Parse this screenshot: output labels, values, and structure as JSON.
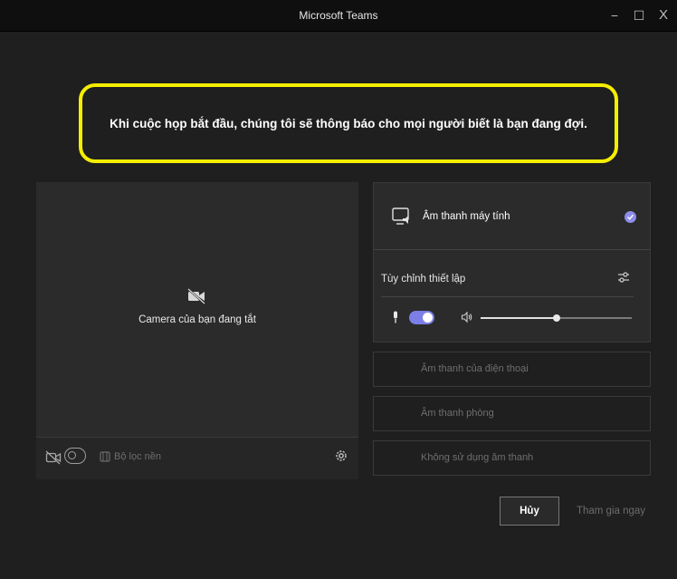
{
  "window": {
    "title": "Microsoft Teams",
    "controls": {
      "minimize": "−",
      "maximize": "☐",
      "close": "X"
    }
  },
  "banner": {
    "text": "Khi cuộc họp bắt đầu, chúng tôi sẽ thông báo cho mọi người biết là bạn đang đợi."
  },
  "video_preview": {
    "camera_status": "Camera của bạn đang tắt",
    "camera_toggle_on": false,
    "background_filters_label": "Bộ lọc nền"
  },
  "audio": {
    "computer_audio_label": "Âm thanh máy tính",
    "computer_audio_selected": true,
    "custom_setup_label": "Tùy chỉnh thiết lập",
    "mic_on": true,
    "speaker_volume_fraction": 0.5,
    "options": [
      {
        "label": "Âm thanh của điện thoại"
      },
      {
        "label": "Âm thanh phòng"
      },
      {
        "label": "Không sử dụng âm thanh"
      }
    ]
  },
  "actions": {
    "cancel_label": "Hủy",
    "join_label": "Tham gia ngay"
  },
  "colors": {
    "accent": "#7b7fe6",
    "highlight_border": "#f5ee00",
    "background": "#1f1f1f"
  },
  "icons": [
    "video-off-icon",
    "camera-toggle-icon",
    "background-filter-icon",
    "settings-gear-icon",
    "computer-audio-icon",
    "checkmark-icon",
    "sliders-icon",
    "microphone-icon",
    "speaker-icon"
  ]
}
